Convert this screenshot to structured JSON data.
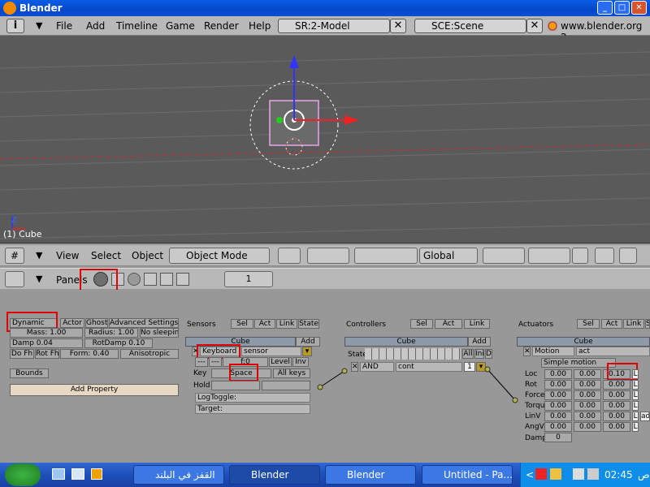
{
  "titlebar": {
    "title": "Blender"
  },
  "menu": {
    "items": [
      "File",
      "Add",
      "Timeline",
      "Game",
      "Render",
      "Help"
    ],
    "screen_field": "SR:2-Model",
    "scene_field": "SCE:Scene",
    "url": "www.blender.org 2"
  },
  "viewport": {
    "object_label": "(1) Cube"
  },
  "vp_toolbar": {
    "view": "View",
    "select": "Select",
    "object": "Object",
    "mode": "Object Mode",
    "orientation": "Global"
  },
  "panels_bar": {
    "label": "Panels",
    "page": "1"
  },
  "physics": {
    "type": "Dynamic",
    "buttons": [
      "Actor",
      "Ghost",
      "Advanced Settings"
    ],
    "mass": "Mass: 1.00",
    "radius": "Radius: 1.00",
    "no_sleeping": "No sleeping",
    "damp": "Damp 0.04",
    "rotdamp": "RotDamp 0.10",
    "do_fh": "Do Fh",
    "rot_fh": "Rot Fh",
    "form": "Form: 0.40",
    "anisotropic": "Anisotropic",
    "bounds": "Bounds",
    "add_property": "Add Property"
  },
  "sensors": {
    "title": "Sensors",
    "tabs": [
      "Sel",
      "Act",
      "Link",
      "State"
    ],
    "object": "Cube",
    "add": "Add",
    "type": "Keyboard",
    "name": "sensor",
    "freq": "f:0",
    "level": "Level",
    "inv": "Inv",
    "key_label": "Key",
    "key_value": "Space",
    "all_keys": "All keys",
    "hold_label": "Hold",
    "logtoggle": "LogToggle:",
    "target": "Target:"
  },
  "controllers": {
    "title": "Controllers",
    "tabs": [
      "Sel",
      "Act",
      "Link"
    ],
    "object": "Cube",
    "add": "Add",
    "state_label": "State",
    "all": "All",
    "ini": "Ini",
    "d": "D",
    "type": "AND",
    "name": "cont",
    "priority": "1"
  },
  "actuators": {
    "title": "Actuators",
    "tabs": [
      "Sel",
      "Act",
      "Link",
      "S"
    ],
    "object": "Cube",
    "type": "Motion",
    "name": "act",
    "mode": "Simple motion",
    "rows": [
      {
        "label": "Loc",
        "values": [
          "0.00",
          "0.00",
          "0.10"
        ]
      },
      {
        "label": "Rot",
        "values": [
          "0.00",
          "0.00",
          "0.00"
        ]
      },
      {
        "label": "Force",
        "values": [
          "0.00",
          "0.00",
          "0.00"
        ]
      },
      {
        "label": "Torque",
        "values": [
          "0.00",
          "0.00",
          "0.00"
        ]
      },
      {
        "label": "LinV",
        "values": [
          "0.00",
          "0.00",
          "0.00"
        ]
      },
      {
        "label": "AngV",
        "values": [
          "0.00",
          "0.00",
          "0.00"
        ]
      }
    ],
    "damp_label": "Damp",
    "damp_value": "0",
    "local_flag": "L",
    "add_flag": "ad"
  },
  "taskbar": {
    "tasks": [
      {
        "label": "القفز في البلند"
      },
      {
        "label": "Blender"
      },
      {
        "label": "Blender"
      },
      {
        "label": "Untitled - Pa..."
      }
    ],
    "clock": "02:45",
    "ampm": "ص"
  },
  "colors": {
    "highlight": "#e00000",
    "title_blue": "#0a5de6",
    "taskbar_blue": "#1d4fb8"
  }
}
